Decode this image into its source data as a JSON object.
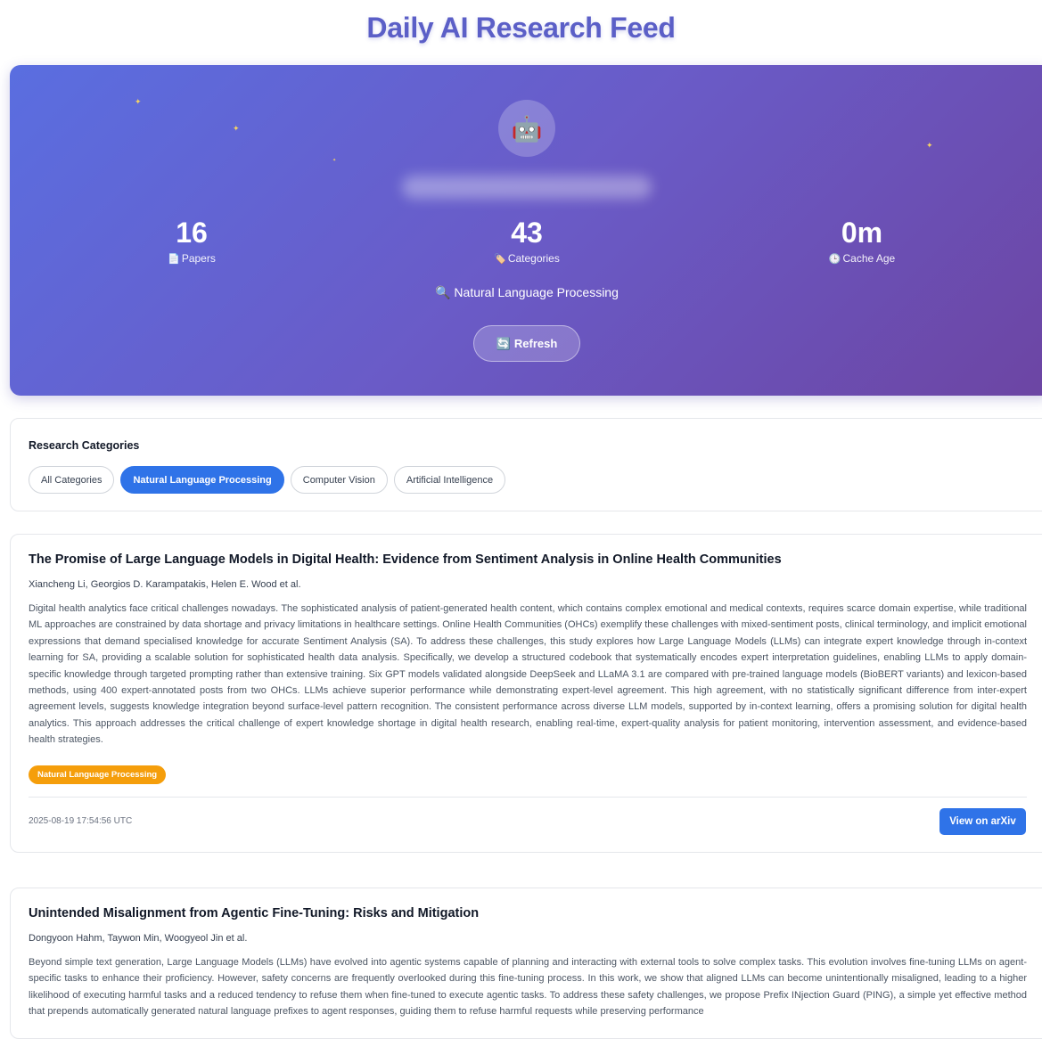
{
  "page": {
    "title": "Daily AI Research Feed"
  },
  "hero": {
    "avatar_icon": "robot-icon",
    "avatar_glyph": "🤖",
    "stats": [
      {
        "value": "16",
        "label": "Papers",
        "icon": "📄"
      },
      {
        "value": "43",
        "label": "Categories",
        "icon": "🏷️"
      },
      {
        "value": "0m",
        "label": "Cache Age",
        "icon": "🕒"
      }
    ],
    "current_category": "Natural Language Processing",
    "current_category_icon": "🔍",
    "refresh_icon": "🔄",
    "refresh_label": "Refresh"
  },
  "categories": {
    "title": "Research Categories",
    "items": [
      {
        "label": "All Categories",
        "active": false
      },
      {
        "label": "Natural Language Processing",
        "active": true
      },
      {
        "label": "Computer Vision",
        "active": false
      },
      {
        "label": "Artificial Intelligence",
        "active": false
      }
    ]
  },
  "papers": [
    {
      "title": "The Promise of Large Language Models in Digital Health: Evidence from Sentiment Analysis in Online Health Communities",
      "authors": "Xiancheng Li, Georgios D. Karampatakis, Helen E. Wood et al.",
      "abstract": "Digital health analytics face critical challenges nowadays. The sophisticated analysis of patient-generated health content, which contains complex emotional and medical contexts, requires scarce domain expertise, while traditional ML approaches are constrained by data shortage and privacy limitations in healthcare settings. Online Health Communities (OHCs) exemplify these challenges with mixed-sentiment posts, clinical terminology, and implicit emotional expressions that demand specialised knowledge for accurate Sentiment Analysis (SA). To address these challenges, this study explores how Large Language Models (LLMs) can integrate expert knowledge through in-context learning for SA, providing a scalable solution for sophisticated health data analysis. Specifically, we develop a structured codebook that systematically encodes expert interpretation guidelines, enabling LLMs to apply domain-specific knowledge through targeted prompting rather than extensive training. Six GPT models validated alongside DeepSeek and LLaMA 3.1 are compared with pre-trained language models (BioBERT variants) and lexicon-based methods, using 400 expert-annotated posts from two OHCs. LLMs achieve superior performance while demonstrating expert-level agreement. This high agreement, with no statistically significant difference from inter-expert agreement levels, suggests knowledge integration beyond surface-level pattern recognition. The consistent performance across diverse LLM models, supported by in-context learning, offers a promising solution for digital health analytics. This approach addresses the critical challenge of expert knowledge shortage in digital health research, enabling real-time, expert-quality analysis for patient monitoring, intervention assessment, and evidence-based health strategies.",
      "tag": "Natural Language Processing",
      "timestamp": "2025-08-19 17:54:56 UTC",
      "link_label": "View on arXiv"
    },
    {
      "title": "Unintended Misalignment from Agentic Fine-Tuning: Risks and Mitigation",
      "authors": "Dongyoon Hahm, Taywon Min, Woogyeol Jin et al.",
      "abstract": "Beyond simple text generation, Large Language Models (LLMs) have evolved into agentic systems capable of planning and interacting with external tools to solve complex tasks. This evolution involves fine-tuning LLMs on agent-specific tasks to enhance their proficiency. However, safety concerns are frequently overlooked during this fine-tuning process. In this work, we show that aligned LLMs can become unintentionally misaligned, leading to a higher likelihood of executing harmful tasks and a reduced tendency to refuse them when fine-tuned to execute agentic tasks. To address these safety challenges, we propose Prefix INjection Guard (PING), a simple yet effective method that prepends automatically generated natural language prefixes to agent responses, guiding them to refuse harmful requests while preserving performance",
      "tag": "",
      "timestamp": "",
      "link_label": ""
    }
  ]
}
